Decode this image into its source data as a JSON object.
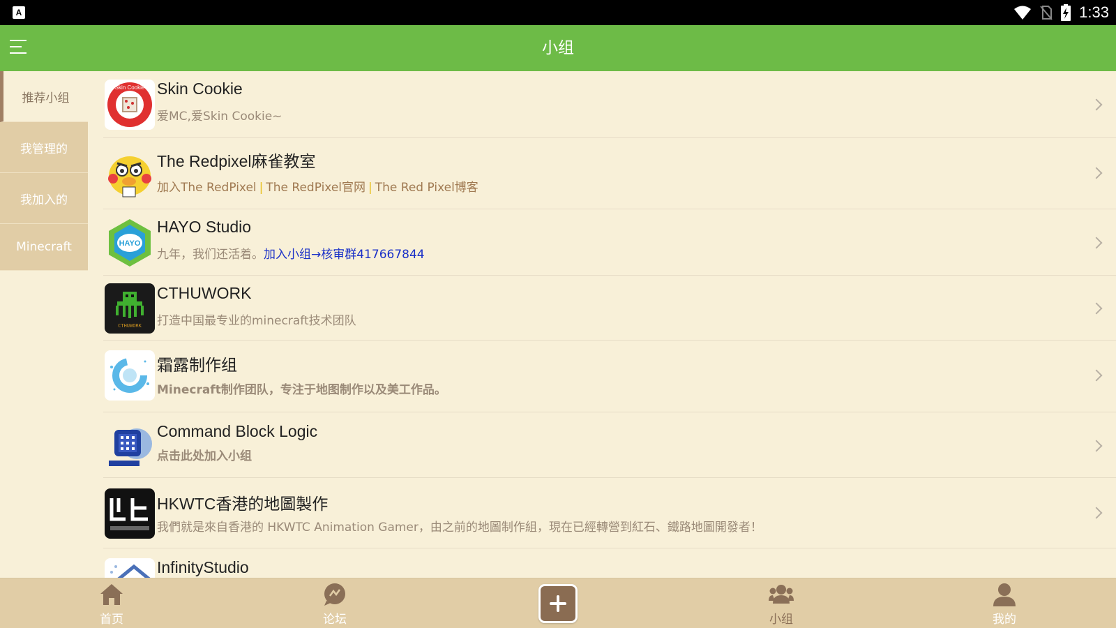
{
  "status_bar": {
    "app_badge": "A",
    "time": "1:33"
  },
  "app_bar": {
    "title": "小组"
  },
  "sidebar": {
    "items": [
      {
        "label": "推荐小组",
        "active": true
      },
      {
        "label": "我管理的",
        "active": false
      },
      {
        "label": "我加入的",
        "active": false
      },
      {
        "label": "Minecraft",
        "active": false
      }
    ]
  },
  "groups": [
    {
      "name": "Skin Cookie",
      "desc": "爱MC,爱Skin Cookie~",
      "logo_text": "Skin Cookie"
    },
    {
      "name": "The Redpixel麻雀教室",
      "desc_parts": [
        "加入The RedPixel",
        "|",
        "The RedPixel官网",
        "|",
        "The Red Pixel博客"
      ]
    },
    {
      "name": "HAYO Studio",
      "desc": "九年，我们还活着。",
      "desc_link": "加入小组→核审群417667844",
      "logo_text": "HAYO"
    },
    {
      "name": "CTHUWORK",
      "desc": "打造中国最专业的minecraft技术团队",
      "logo_text": "CTHUWORK"
    },
    {
      "name": "霜露制作组",
      "desc": "Minecraft制作团队，专注于地图制作以及美工作品。"
    },
    {
      "name": "Command Block Logic",
      "desc": "点击此处加入小组"
    },
    {
      "name": "HKWTC香港的地圖製作",
      "desc": "我們就是來自香港的 HKWTC Animation Gamer，由之前的地圖制作組，現在已經轉營到紅石、鐵路地圖開發者！"
    },
    {
      "name": "InfinityStudio"
    }
  ],
  "bottom_nav": {
    "items": [
      {
        "label": "首页",
        "icon": "home-icon"
      },
      {
        "label": "论坛",
        "icon": "chat-icon"
      },
      {
        "label": "小组",
        "icon": "group-icon",
        "active": true
      },
      {
        "label": "我的",
        "icon": "profile-icon"
      }
    ],
    "center_button": "plus-icon"
  },
  "colors": {
    "primary": "#6dbb47",
    "background": "#f8f0d8",
    "sidebar": "#e1cda6",
    "accent_brown": "#8a6c52"
  }
}
